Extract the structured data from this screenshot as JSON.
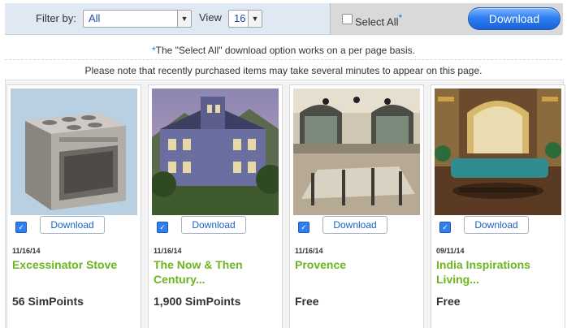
{
  "toolbar": {
    "filter_label": "Filter by:",
    "filter_value": "All",
    "view_label": "View",
    "view_value": "16",
    "select_all_label": "Select All",
    "select_all_star": "*",
    "download_label": "Download"
  },
  "notes": {
    "select_all_note_star": "*",
    "select_all_note": "The \"Select All\" download option works on a per page basis.",
    "recent_note": "Please note that recently purchased items may take several minutes to appear on this page."
  },
  "items": [
    {
      "date": "11/16/14",
      "title": "Excessinator Stove",
      "price": "56 SimPoints",
      "download_label": "Download",
      "checked": true
    },
    {
      "date": "11/16/14",
      "title": "The Now & Then Century...",
      "price": "1,900 SimPoints",
      "download_label": "Download",
      "checked": true
    },
    {
      "date": "11/16/14",
      "title": "Provence",
      "price": "Free",
      "download_label": "Download",
      "checked": true
    },
    {
      "date": "09/11/14",
      "title": "India Inspirations Living...",
      "price": "Free",
      "download_label": "Download",
      "checked": true
    }
  ],
  "colors": {
    "accent_blue": "#2f7ff1",
    "title_green": "#6cb51f",
    "toolbar_bg": "#dfe8f3"
  }
}
